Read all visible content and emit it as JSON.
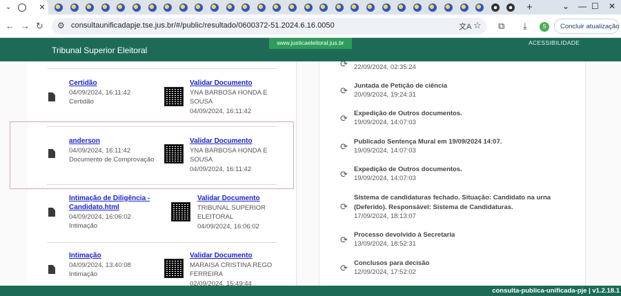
{
  "browser": {
    "url": "consultaunificadapje.tse.jus.br/#/public/resultado/0600372-51.2024.6.16.0050",
    "update_button": "Concluir atualização",
    "profile_initial": "S"
  },
  "header": {
    "brand": "Tribunal Superior Eleitoral",
    "site_link": "www.justicaeleitoral.jus.br",
    "accessibility": "ACESSIBILIDADE"
  },
  "documents": [
    {
      "title": "Certidão",
      "date": "04/09/2024, 16:11:42",
      "type": "Certidão",
      "validate": "Validar Documento",
      "signer_line1": "YNA BARBOSA HONDA E",
      "signer_line2": "SOUSA",
      "sign_date": "04/09/2024, 16:11:42"
    },
    {
      "title": "anderson",
      "date": "04/09/2024, 16:11:42",
      "type": "Documento de Comprovação",
      "validate": "Validar Documento",
      "signer_line1": "YNA BARBOSA HONDA E",
      "signer_line2": "SOUSA",
      "sign_date": "04/09/2024, 16:11:42"
    },
    {
      "title_line1": "Intimação de Diligência -",
      "title_line2": "Candidato.html",
      "date": "04/09/2024, 16:06:02",
      "type": "Intimação",
      "validate": "Validar Documento",
      "signer_line1": "TRIBUNAL SUPERIOR",
      "signer_line2": "ELEITORAL",
      "sign_date": "04/09/2024, 16:06:02"
    },
    {
      "title": "Intimação",
      "date": "04/09/2024, 13:40:08",
      "type": "Intimação",
      "validate": "Validar Documento",
      "signer_line1": "MARAISA CRISTINA REGO",
      "signer_line2": "FERREIRA",
      "sign_date": "02/09/2024, 15:49:44"
    }
  ],
  "events": [
    {
      "title": "",
      "date": "22/09/2024, 02:35:24"
    },
    {
      "title": "Juntada de Petição de ciência",
      "date": "20/09/2024, 19:24:31"
    },
    {
      "title": "Expedição de Outros documentos.",
      "date": "19/09/2024, 14:07:03"
    },
    {
      "title": "Publicado Sentença Mural em 19/09/2024 14:07.",
      "date": "19/09/2024, 14:07:03"
    },
    {
      "title": "Expedição de Outros documentos.",
      "date": "19/09/2024, 14:07:03"
    },
    {
      "title": "Sistema de candidaturas fechado. Situação: Candidato na urna (Deferido). Responsável: Sistema de Candidaturas.",
      "date": "17/09/2024, 18:13:07"
    },
    {
      "title": "Processo devolvido à Secretaria",
      "date": "13/09/2024, 18:52:31"
    },
    {
      "title": "Conclusos para decisão",
      "date": "12/09/2024, 17:52:02"
    }
  ],
  "footer": {
    "version": "consulta-publica-unificada-pje | v1.2.18.1"
  }
}
